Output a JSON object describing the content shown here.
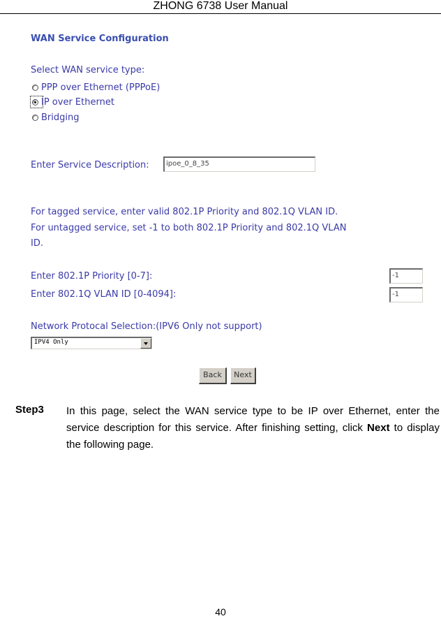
{
  "header": {
    "title": "ZHONG 6738 User Manual"
  },
  "screenshot": {
    "title": "WAN Service Configuration",
    "service_type": {
      "label": "Select WAN service type:",
      "options": [
        {
          "label": "PPP over Ethernet (PPPoE)",
          "selected": false
        },
        {
          "label": "IP over Ethernet",
          "selected": true
        },
        {
          "label": "Bridging",
          "selected": false
        }
      ]
    },
    "service_description": {
      "label": "Enter Service Description:",
      "value": "ipoe_0_8_35"
    },
    "vlan_note": {
      "line1": "For tagged service, enter valid 802.1P Priority and 802.1Q VLAN ID.",
      "line2": "For untagged service, set -1 to both 802.1P Priority and 802.1Q VLAN",
      "line3": "ID."
    },
    "priority": {
      "label": "Enter 802.1P Priority [0-7]:",
      "value": "-1"
    },
    "vlan_id": {
      "label": "Enter 802.1Q VLAN ID [0-4094]:",
      "value": "-1"
    },
    "protocol": {
      "label": "Network Protocal Selection:(IPV6 Only not support)",
      "value": "IPV4 Only"
    },
    "buttons": {
      "back": "Back",
      "next": "Next"
    }
  },
  "body": {
    "step_label": "Step3",
    "text_before": "In this page, select the WAN service type to be IP over Ethernet, enter the service description for this service. After finishing setting, click ",
    "text_bold": "Next",
    "text_after": " to display the following page."
  },
  "footer": {
    "page_number": "40"
  }
}
